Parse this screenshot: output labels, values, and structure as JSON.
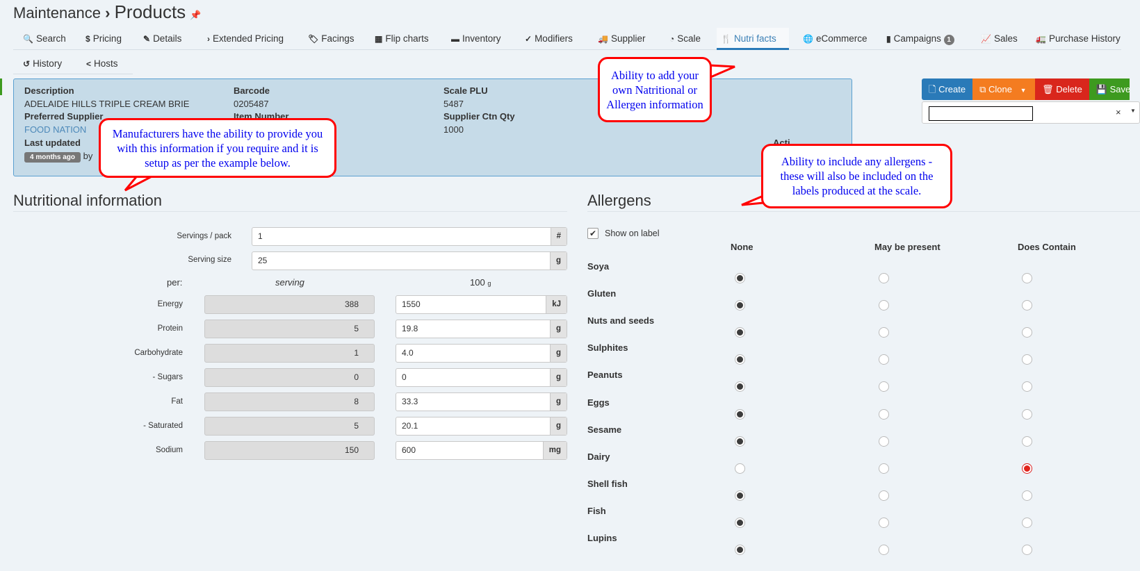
{
  "breadcrumb": {
    "parent": "Maintenance",
    "separator": "›",
    "current": "Products",
    "pin_icon": "thumbtack-icon"
  },
  "tabs": [
    {
      "label": "Search",
      "icon": "search-icon"
    },
    {
      "label": "Pricing",
      "icon": "dollar-icon"
    },
    {
      "label": "Details",
      "icon": "edit-icon"
    },
    {
      "label": "Extended Pricing",
      "icon": "chevron-right-icon"
    },
    {
      "label": "Facings",
      "icon": "tags-icon"
    },
    {
      "label": "Flip charts",
      "icon": "grid-icon"
    },
    {
      "label": "Inventory",
      "icon": "archive-icon"
    },
    {
      "label": "Modifiers",
      "icon": "check-circle-icon"
    },
    {
      "label": "Supplier",
      "icon": "truck-icon"
    },
    {
      "label": "Scale",
      "icon": "tachometer-icon"
    },
    {
      "label": "Nutri facts",
      "icon": "utensils-icon",
      "active": true
    },
    {
      "label": "eCommerce",
      "icon": "globe-icon"
    },
    {
      "label": "Campaigns",
      "icon": "calendar-icon",
      "badge": "1"
    },
    {
      "label": "Sales",
      "icon": "line-chart-icon"
    },
    {
      "label": "Purchase History",
      "icon": "truck-loading-icon"
    }
  ],
  "tabs2": [
    {
      "label": "History",
      "icon": "history-icon"
    },
    {
      "label": "Hosts",
      "icon": "share-icon"
    }
  ],
  "info": {
    "description_label": "Description",
    "description": "ADELAIDE HILLS TRIPLE CREAM BRIE",
    "barcode_label": "Barcode",
    "barcode": "0205487",
    "scale_plu_label": "Scale PLU",
    "scale_plu": "5487",
    "preferred_supplier_label": "Preferred Supplier",
    "preferred_supplier": "FOOD NATION",
    "item_number_label": "Item Number",
    "supplier_ctn_qty_label": "Supplier Ctn Qty",
    "supplier_ctn_qty": "1000",
    "last_updated_label": "Last updated",
    "last_updated": "4 months ago",
    "by": "by",
    "actions_label": "Acti"
  },
  "actions": {
    "create": "Create",
    "clone": "Clone",
    "delete": "Delete",
    "save": "Save",
    "colors": {
      "create": "#2a7ab8",
      "clone": "#f47c20",
      "delete": "#d9261c",
      "save": "#3d9a1f"
    }
  },
  "select": {
    "value": "",
    "clear": "×"
  },
  "nutrition": {
    "title": "Nutritional information",
    "servings_label": "Servings / pack",
    "servings": "1",
    "servings_unit": "#",
    "serving_size_label": "Serving size",
    "serving_size": "25",
    "serving_size_unit": "g",
    "per_label": "per:",
    "per_serving": "serving",
    "per_100": "100",
    "per_100_unit": "g",
    "rows": [
      {
        "label": "Energy",
        "serving": "388",
        "per100": "1550",
        "unit": "kJ"
      },
      {
        "label": "Protein",
        "serving": "5",
        "per100": "19.8",
        "unit": "g"
      },
      {
        "label": "Carbohydrate",
        "serving": "1",
        "per100": "4.0",
        "unit": "g"
      },
      {
        "label": "- Sugars",
        "serving": "0",
        "per100": "0",
        "unit": "g"
      },
      {
        "label": "Fat",
        "serving": "8",
        "per100": "33.3",
        "unit": "g"
      },
      {
        "label": "- Saturated",
        "serving": "5",
        "per100": "20.1",
        "unit": "g"
      },
      {
        "label": "Sodium",
        "serving": "150",
        "per100": "600",
        "unit": "mg"
      }
    ]
  },
  "allergens": {
    "title": "Allergens",
    "show_on_label": "Show on label",
    "show_on_label_checked": true,
    "columns": [
      "None",
      "May be present",
      "Does Contain"
    ],
    "items": [
      {
        "name": "Soya",
        "value": "None"
      },
      {
        "name": "Gluten",
        "value": "None"
      },
      {
        "name": "Nuts and seeds",
        "value": "None"
      },
      {
        "name": "Sulphites",
        "value": "None"
      },
      {
        "name": "Peanuts",
        "value": "None"
      },
      {
        "name": "Eggs",
        "value": "None"
      },
      {
        "name": "Sesame",
        "value": "None"
      },
      {
        "name": "Dairy",
        "value": "Does Contain"
      },
      {
        "name": "Shell fish",
        "value": "None"
      },
      {
        "name": "Fish",
        "value": "None"
      },
      {
        "name": "Lupins",
        "value": "None"
      }
    ]
  },
  "callouts": [
    "Manufacturers have the ability to provide you with this information if you require and it is setup as per the example below.",
    "Ability to add your own Natritional or Allergen information",
    "Ability to include any allergens - these will also be included on the labels produced at the scale."
  ]
}
